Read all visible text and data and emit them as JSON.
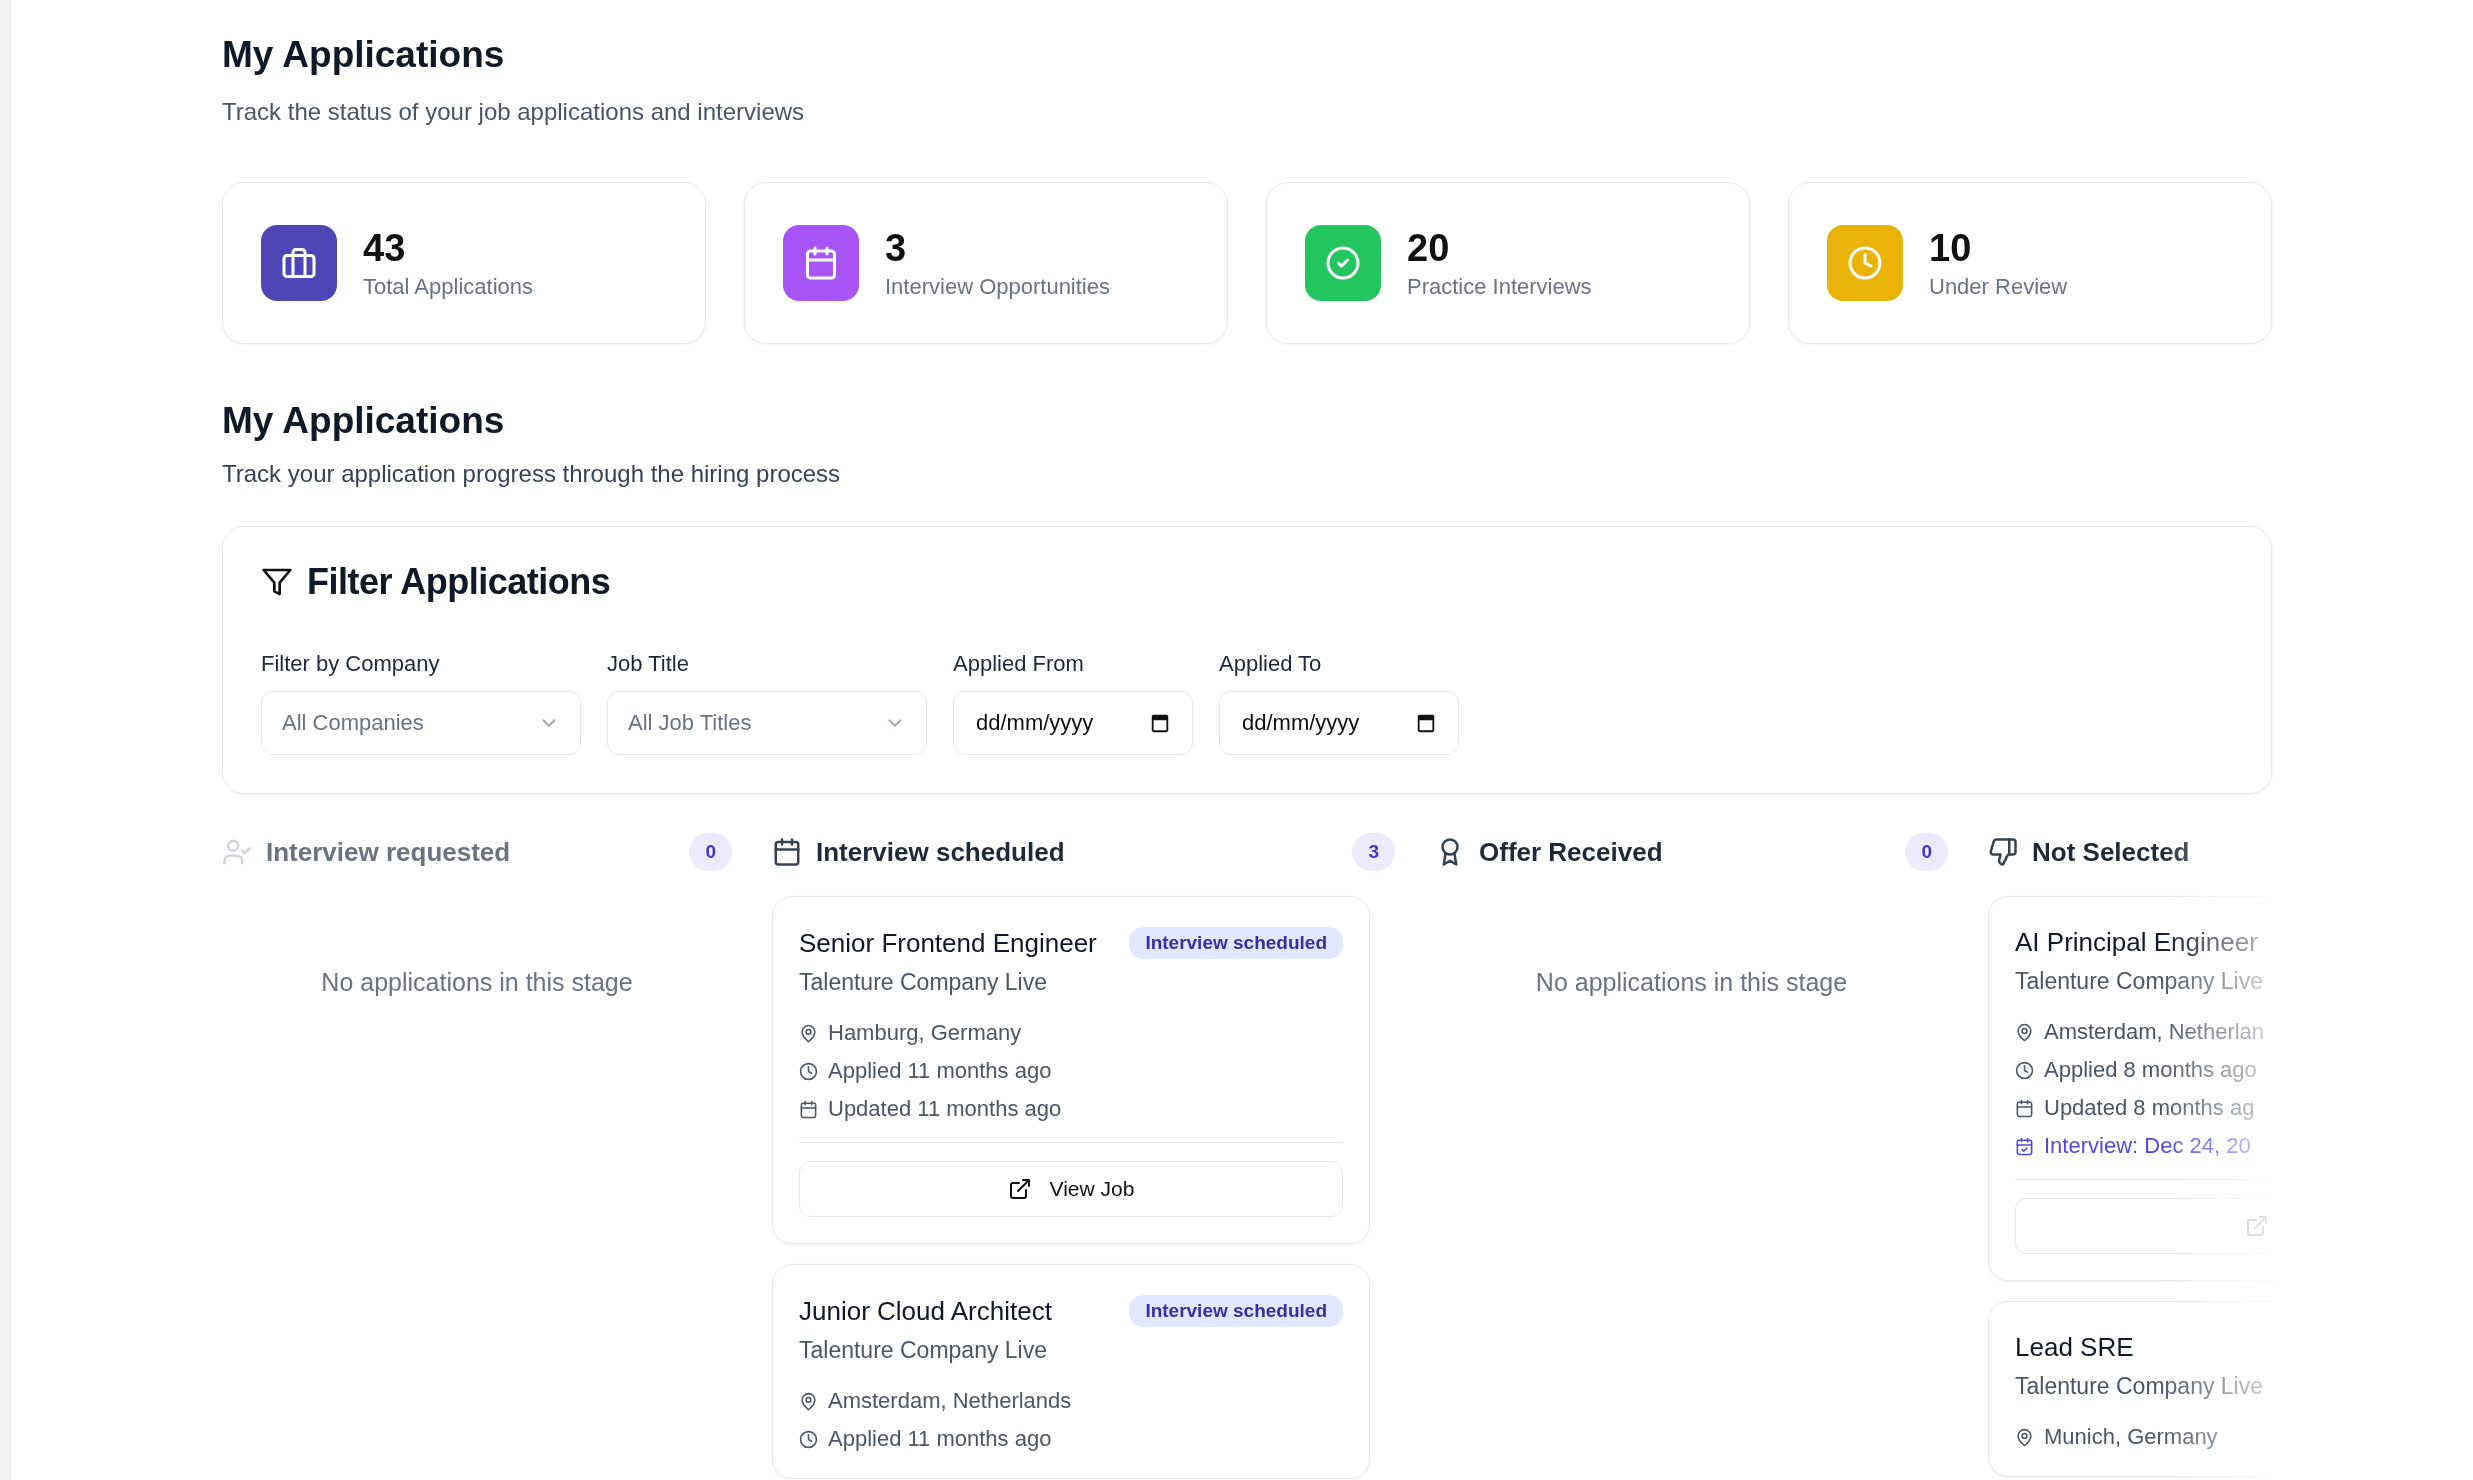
{
  "header": {
    "title": "My Applications",
    "subtitle": "Track the status of your job applications and interviews"
  },
  "stats": [
    {
      "value": "43",
      "label": "Total Applications",
      "kind": "briefcase",
      "color": "#4f46b5"
    },
    {
      "value": "3",
      "label": "Interview Opportunities",
      "kind": "calendar",
      "color": "#a855f7"
    },
    {
      "value": "20",
      "label": "Practice Interviews",
      "kind": "check",
      "color": "#22c55e"
    },
    {
      "value": "10",
      "label": "Under Review",
      "kind": "clock",
      "color": "#eab308"
    }
  ],
  "section": {
    "title": "My Applications",
    "subtitle": "Track your application progress through the hiring process"
  },
  "filter": {
    "title": "Filter Applications",
    "fields": [
      {
        "label": "Filter by Company",
        "kind": "select",
        "value": "All Companies"
      },
      {
        "label": "Job Title",
        "kind": "select",
        "value": "All Job Titles"
      },
      {
        "label": "Applied From",
        "kind": "date",
        "placeholder": "dd/mm/yyyy"
      },
      {
        "label": "Applied To",
        "kind": "date",
        "placeholder": "dd/mm/yyyy"
      }
    ]
  },
  "columns": [
    {
      "title": "Interview requested",
      "kind": "user-check",
      "count": "0",
      "empty_text": "No applications in this stage"
    },
    {
      "title": "Interview scheduled",
      "kind": "calendar",
      "count": "3",
      "cards": [
        {
          "title": "Senior Frontend Engineer",
          "badge": "Interview scheduled",
          "company": "Talenture Company Live",
          "meta": [
            {
              "kind": "location",
              "text": "Hamburg, Germany"
            },
            {
              "kind": "applied",
              "text": "Applied 11 months ago"
            },
            {
              "kind": "updated",
              "text": "Updated 11 months ago"
            }
          ],
          "button": "View Job"
        },
        {
          "title": "Junior Cloud Architect",
          "badge": "Interview scheduled",
          "company": "Talenture Company Live",
          "meta": [
            {
              "kind": "location",
              "text": "Amsterdam, Netherlands"
            },
            {
              "kind": "applied",
              "text": "Applied 11 months ago"
            }
          ]
        }
      ]
    },
    {
      "title": "Offer Received",
      "kind": "award",
      "count": "0",
      "empty_text": "No applications in this stage"
    },
    {
      "title": "Not Selected",
      "kind": "thumbs-down",
      "cards": [
        {
          "title": "AI Principal Engineer",
          "company": "Talenture Company Live",
          "meta": [
            {
              "kind": "location",
              "text": "Amsterdam, Netherlan"
            },
            {
              "kind": "applied",
              "text": "Applied 8 months ago"
            },
            {
              "kind": "updated",
              "text": "Updated 8 months ag"
            },
            {
              "kind": "interview",
              "text": "Interview: Dec 24, 20"
            }
          ],
          "has_button": true
        },
        {
          "title": "Lead SRE",
          "company": "Talenture Company Live",
          "meta": [
            {
              "kind": "location",
              "text": "Munich, Germany"
            }
          ]
        }
      ]
    }
  ]
}
